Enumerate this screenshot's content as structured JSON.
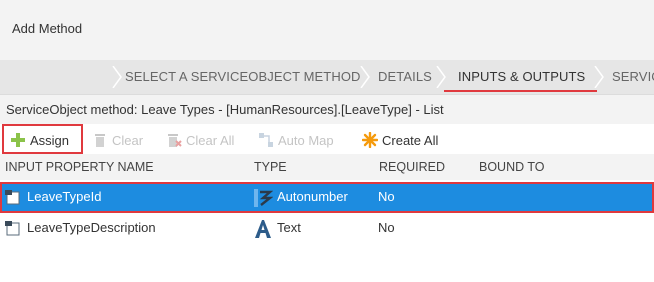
{
  "header": {
    "title": "Add Method"
  },
  "wizard": {
    "steps": [
      {
        "label": "SELECT A SERVICEOBJECT METHOD",
        "active": false
      },
      {
        "label": "DETAILS",
        "active": false
      },
      {
        "label": "INPUTS & OUTPUTS",
        "active": true
      },
      {
        "label": "SERVIC",
        "active": false
      }
    ]
  },
  "method_line": "ServiceObject method: Leave Types - [HumanResources].[LeaveType] - List",
  "toolbar": {
    "assign": "Assign",
    "clear": "Clear",
    "clear_all": "Clear All",
    "auto_map": "Auto Map",
    "create_all": "Create All"
  },
  "grid": {
    "columns": {
      "input_property_name": "INPUT PROPERTY NAME",
      "type": "TYPE",
      "required": "REQUIRED",
      "bound_to": "BOUND TO"
    },
    "rows": [
      {
        "name": "LeaveTypeId",
        "type": "Autonumber",
        "type_icon": "autonumber-icon",
        "required": "No",
        "bound_to": "",
        "selected": true
      },
      {
        "name": "LeaveTypeDescription",
        "type": "Text",
        "type_icon": "text-type-icon",
        "required": "No",
        "bound_to": "",
        "selected": false
      }
    ]
  },
  "colors": {
    "selection": "#1d8ce0",
    "highlight_border": "#e0393e",
    "assign_plus": "#8bc34a",
    "create_all_star": "#f59a0c"
  }
}
